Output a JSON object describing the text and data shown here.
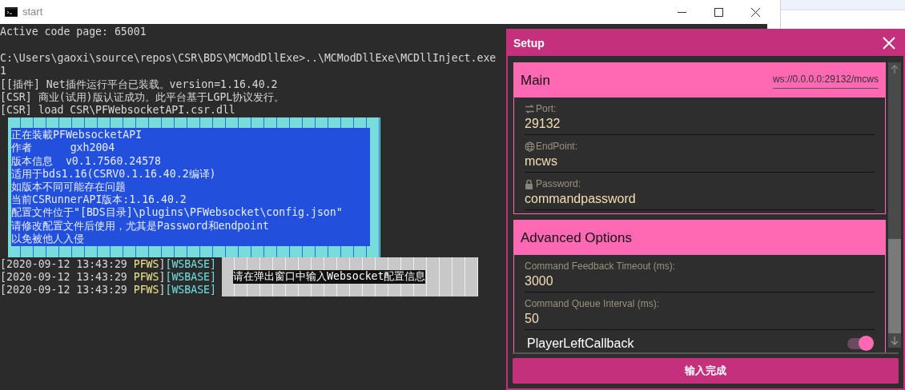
{
  "console": {
    "title": "start",
    "header": [
      "Active code page: 65001"
    ],
    "lines": [
      "C:\\Users\\gaoxi\\source\\repos\\CSR\\BDS\\MCModDllExe>..\\MCModDllExe\\MCDllInject.exe",
      "1",
      "[[插件] Net插件运行平台已装载。version=1.16.40.2",
      "[CSR] 商业(试用)版认证成功。此平台基于LGPL协议发行。",
      "[CSR] load CSR\\PFWebsocketAPI.csr.dll"
    ],
    "banner": [
      "正在装載PFWebsocketAPI",
      "作者      gxh2004",
      "版本信息  v0.1.7560.24578",
      "适用于bds1.16(CSRV0.1.16.40.2编译)",
      "如版本不同可能存在问题",
      "当前CSRunnerAPI版本:1.16.40.2",
      "配置文件位于\"[BDS目录]\\plugins\\PFWebsocket\\config.json\"",
      "请修改配置文件后使用，尤其是Password和endpoint",
      "以免被他人入侵"
    ],
    "log": [
      {
        "time": "[2020-09-12 13:43:29 ",
        "source": "PFWS",
        "close": "]",
        "tag": "[WSBASE]"
      },
      {
        "time": "[2020-09-12 13:43:29 ",
        "source": "PFWS",
        "close": "]",
        "tag": "[WSBASE]"
      },
      {
        "time": "[2020-09-12 13:43:29 ",
        "source": "PFWS",
        "close": "]",
        "tag": "[WSBASE]"
      }
    ],
    "popup": "请在弹出窗口中输入Websocket配置信息"
  },
  "setup": {
    "title": "Setup",
    "sections": [
      {
        "title": "Main",
        "url": "ws://0.0.0.0:29132/mcws",
        "fields": [
          {
            "kind": "field",
            "label": "Port:",
            "value": "29132"
          },
          {
            "kind": "field",
            "label": "EndPoint:",
            "value": "mcws"
          },
          {
            "kind": "field",
            "label": "Password:",
            "value": "commandpassword"
          }
        ]
      },
      {
        "title": "Advanced Options",
        "fields": [
          {
            "kind": "field",
            "label": "Command Feedback Timeout (ms):",
            "value": "3000"
          },
          {
            "kind": "field",
            "label": "Command Queue Interval (ms):",
            "value": "50"
          },
          {
            "kind": "toggle",
            "label": "PlayerLeftCallback",
            "on": true
          }
        ]
      }
    ],
    "button": "输入完成"
  }
}
